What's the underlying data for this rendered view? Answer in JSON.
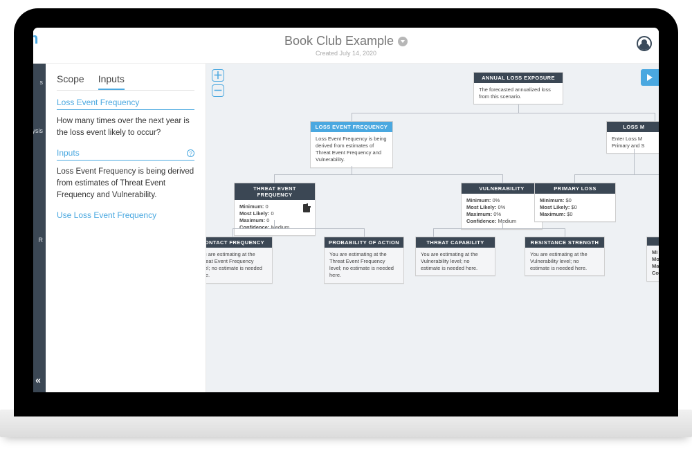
{
  "header": {
    "title": "Book Club Example",
    "subtitle": "Created July 14, 2020",
    "logo_fragment": "n"
  },
  "navrail": {
    "item1": "s",
    "item2": "lysis",
    "item3": "R",
    "collapse_glyph": "«"
  },
  "panel": {
    "tabs": {
      "scope": "Scope",
      "inputs": "Inputs"
    },
    "section1_title": "Loss Event Frequency",
    "section1_body": "How many times over the next year is the loss event likely to occur?",
    "section2_title": "Inputs",
    "section2_body": "Loss Event Frequency is being derived from estimates of Threat Event Frequency and Vulnerability.",
    "action_link": "Use Loss Event Frequency",
    "help_glyph": "?"
  },
  "zoom": {
    "in": "＋",
    "out": "－"
  },
  "tree": {
    "ale": {
      "title": "ANNUAL LOSS EXPOSURE",
      "body": "The forecasted annualized loss from this scenario."
    },
    "lef": {
      "title": "LOSS EVENT FREQUENCY",
      "body": "Loss Event Frequency is being derived from estimates of Threat Event Frequency and Vulnerability."
    },
    "lm": {
      "title": "LOSS M",
      "body": "Enter Loss M\nPrimary and S"
    },
    "tef": {
      "title": "THREAT EVENT FREQUENCY",
      "min_label": "Minimum:",
      "min": "0",
      "ml_label": "Most Likely:",
      "ml": "0",
      "max_label": "Maximum:",
      "max": "0",
      "conf_label": "Confidence:",
      "conf": "Medium"
    },
    "vuln": {
      "title": "VULNERABILITY",
      "min_label": "Minimum:",
      "min": "0%",
      "ml_label": "Most Likely:",
      "ml": "0%",
      "max_label": "Maximum:",
      "max": "0%",
      "conf_label": "Confidence:",
      "conf": "Medium"
    },
    "ploss": {
      "title": "PRIMARY LOSS",
      "min_label": "Minimum:",
      "min": "$0",
      "ml_label": "Most Likely:",
      "ml": "$0",
      "max_label": "Maximum:",
      "max": "$0"
    },
    "cf": {
      "title": "CONTACT FREQUENCY",
      "body": "You are estimating at the Threat Event Frequency level; no estimate is needed here."
    },
    "poa": {
      "title": "PROBABILITY OF ACTION",
      "body": "You are estimating at the Threat Event Frequency level; no estimate is needed here."
    },
    "tcap": {
      "title": "THREAT CAPABILITY",
      "body": "You are estimating at the Vulnerability level; no estimate is needed here."
    },
    "rs": {
      "title": "RESISTANCE STRENGTH",
      "body": "You are estimating at the Vulnerability level; no estimate is needed here."
    },
    "extra": {
      "min_label": "Mi",
      "ml_label": "Mo",
      "max_label": "Ma",
      "conf_label": "Co"
    }
  }
}
